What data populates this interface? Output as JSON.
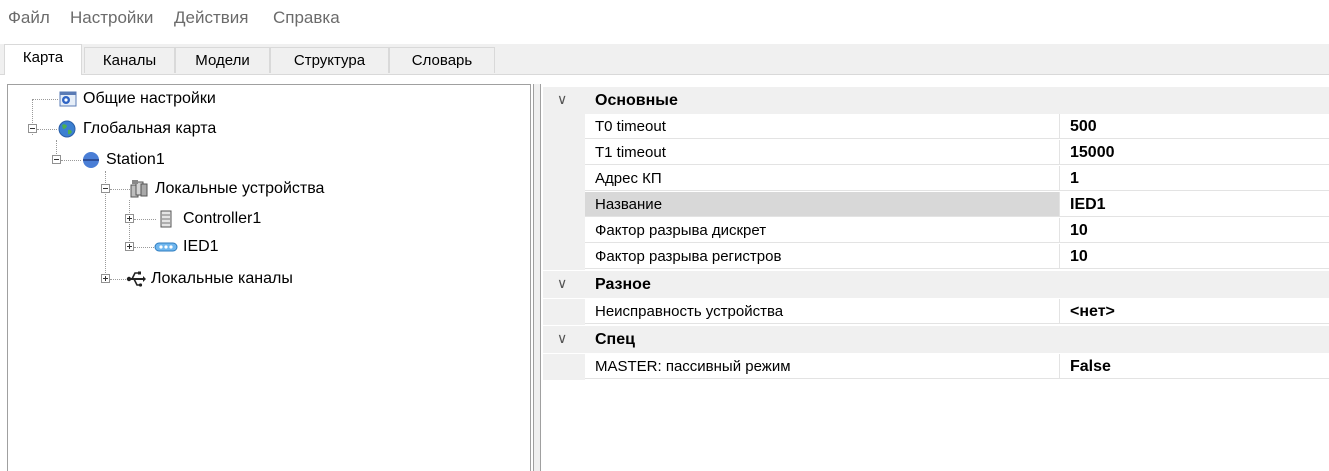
{
  "menu": {
    "items": [
      "Файл",
      "Настройки",
      "Действия",
      "Справка"
    ]
  },
  "tabs": {
    "items": [
      "Карта",
      "Каналы",
      "Модели",
      "Структура",
      "Словарь"
    ],
    "active": "Карта"
  },
  "tree": {
    "general_settings": "Общие настройки",
    "global_map": "Глобальная карта",
    "station": "Station1",
    "local_devices": "Локальные устройства",
    "controller": "Controller1",
    "ied": "IED1",
    "local_channels": "Локальные каналы"
  },
  "properties": {
    "categories": [
      {
        "label": "Основные",
        "rows": [
          {
            "name": "T0 timeout",
            "value": "500"
          },
          {
            "name": "T1 timeout",
            "value": "15000"
          },
          {
            "name": "Адрес КП",
            "value": "1"
          },
          {
            "name": "Название",
            "value": "IED1"
          },
          {
            "name": "Фактор разрыва дискрет",
            "value": "10"
          },
          {
            "name": "Фактор разрыва регистров",
            "value": "10"
          }
        ]
      },
      {
        "label": "Разное",
        "rows": [
          {
            "name": "Неисправность устройства",
            "value": "<нет>"
          }
        ]
      },
      {
        "label": "Спец",
        "rows": [
          {
            "name": "MASTER: пассивный режим",
            "value": "False"
          }
        ]
      }
    ],
    "selected_row": "Название"
  },
  "colors": {
    "selected_row": "#d8d8d8",
    "category_bg": "#f0f0f0",
    "menu_text": "#6b6b6b"
  },
  "icons": {
    "general_settings": "settings-window-icon",
    "global_map": "globe-icon",
    "station": "station-sphere-icon",
    "local_devices": "devices-group-icon",
    "controller": "server-icon",
    "ied": "ied-device-icon",
    "local_channels": "usb-icon"
  }
}
